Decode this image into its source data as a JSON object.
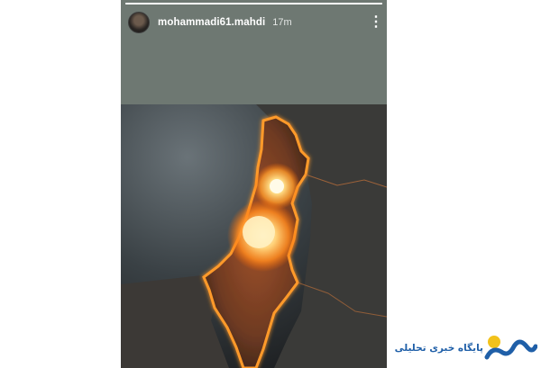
{
  "story": {
    "username": "mohammadi61.mahdi",
    "time_ago": "17m",
    "progress": 1.0,
    "more_icon": "more-vertical-icon",
    "image_subject": "glowing fiery map with two explosions"
  },
  "watermark": {
    "text": "پایگاه خبری تحلیلی",
    "logo_colors": [
      "#1f5fa8",
      "#f2c21b"
    ]
  },
  "colors": {
    "story_background": "#6e7872",
    "glow": "#ff9a2a",
    "page_background": "#ffffff"
  }
}
